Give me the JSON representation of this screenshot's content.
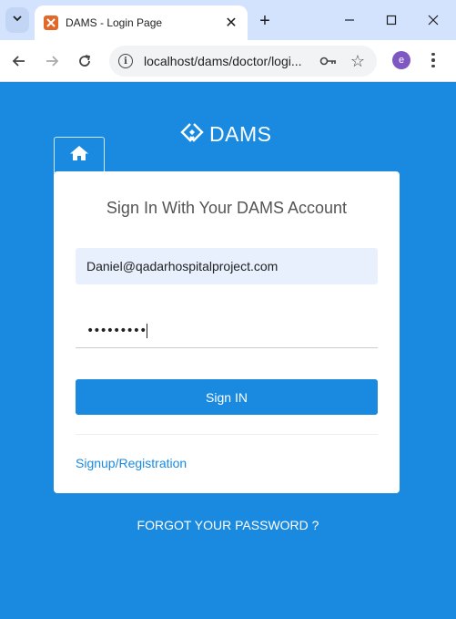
{
  "browser": {
    "tab_title": "DAMS - Login Page",
    "url": "localhost/dams/doctor/logi...",
    "profile_initial": "e"
  },
  "page": {
    "brand_name": "DAMS",
    "heading": "Sign In With Your DAMS Account",
    "email_value": "Daniel@qadarhospitalproject.com",
    "password_mask": "•••••••••",
    "signin_label": "Sign IN",
    "signup_link": "Signup/Registration",
    "forgot_link": "FORGOT YOUR PASSWORD ?"
  },
  "colors": {
    "page_background": "#1a8ae0",
    "accent": "#1a8ae0",
    "tabbar": "#d3e3fd",
    "autofill": "#e8f0fe"
  }
}
